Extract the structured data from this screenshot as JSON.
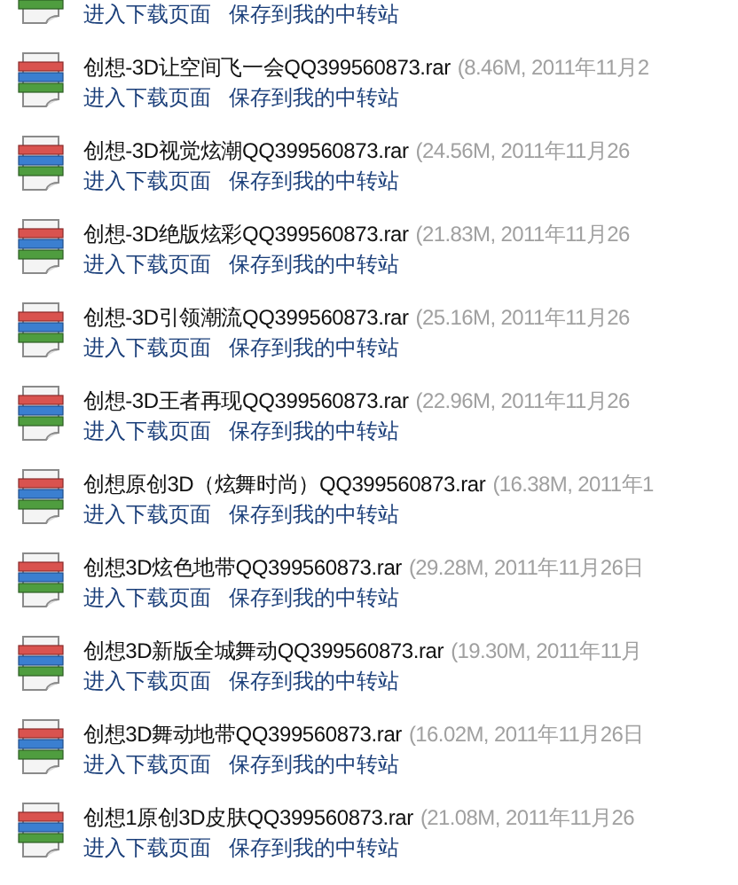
{
  "files": [
    {
      "links": [
        "进入下载页面",
        "保存到我的中转站"
      ]
    },
    {
      "name": "创想-3D让空间飞一会QQ399560873.rar",
      "details": "(8.46M, 2011年11月2",
      "links": [
        "进入下载页面",
        "保存到我的中转站"
      ]
    },
    {
      "name": "创想-3D视觉炫潮QQ399560873.rar",
      "details": "(24.56M, 2011年11月26",
      "links": [
        "进入下载页面",
        "保存到我的中转站"
      ]
    },
    {
      "name": "创想-3D绝版炫彩QQ399560873.rar",
      "details": "(21.83M, 2011年11月26",
      "links": [
        "进入下载页面",
        "保存到我的中转站"
      ]
    },
    {
      "name": "创想-3D引领潮流QQ399560873.rar",
      "details": "(25.16M, 2011年11月26",
      "links": [
        "进入下载页面",
        "保存到我的中转站"
      ]
    },
    {
      "name": "创想-3D王者再现QQ399560873.rar",
      "details": "(22.96M, 2011年11月26",
      "links": [
        "进入下载页面",
        "保存到我的中转站"
      ]
    },
    {
      "name": "创想原创3D（炫舞时尚）QQ399560873.rar",
      "details": "(16.38M, 2011年1",
      "links": [
        "进入下载页面",
        "保存到我的中转站"
      ]
    },
    {
      "name": "创想3D炫色地带QQ399560873.rar",
      "details": "(29.28M, 2011年11月26日",
      "links": [
        "进入下载页面",
        "保存到我的中转站"
      ]
    },
    {
      "name": "创想3D新版全城舞动QQ399560873.rar",
      "details": "(19.30M, 2011年11月",
      "links": [
        "进入下载页面",
        "保存到我的中转站"
      ]
    },
    {
      "name": "创想3D舞动地带QQ399560873.rar",
      "details": "(16.02M, 2011年11月26日",
      "links": [
        "进入下载页面",
        "保存到我的中转站"
      ]
    },
    {
      "name": "创想1原创3D皮肤QQ399560873.rar",
      "details": "(21.08M, 2011年11月26",
      "links": [
        "进入下载页面",
        "保存到我的中转站"
      ]
    }
  ]
}
